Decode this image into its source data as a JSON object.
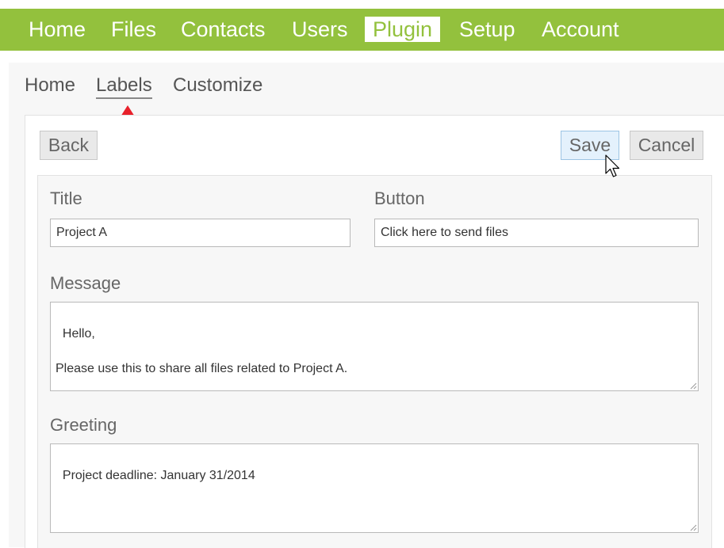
{
  "top_nav": {
    "items": [
      {
        "label": "Home"
      },
      {
        "label": "Files"
      },
      {
        "label": "Contacts"
      },
      {
        "label": "Users"
      },
      {
        "label": "Plugin",
        "active": true
      },
      {
        "label": "Setup"
      },
      {
        "label": "Account"
      }
    ]
  },
  "sub_nav": {
    "items": [
      {
        "label": "Home"
      },
      {
        "label": "Labels",
        "active": true
      },
      {
        "label": "Customize"
      }
    ]
  },
  "toolbar": {
    "back_label": "Back",
    "save_label": "Save",
    "cancel_label": "Cancel"
  },
  "form": {
    "title_label": "Title",
    "title_value": "Project A",
    "button_label": "Button",
    "button_value": "Click here to send files",
    "message_label": "Message",
    "message_value": "Hello,\n\nPlease use this to share all files related to Project A.",
    "greeting_label": "Greeting",
    "greeting_value": "Project deadline: January 31/2014"
  },
  "colors": {
    "brand_green": "#93c13d",
    "marker_red": "#e8212b",
    "save_button_bg": "#e4f1fc"
  },
  "icons": {
    "marker": "red-triangle-up-icon",
    "cursor": "mouse-pointer-icon",
    "resize": "resize-grip-icon"
  }
}
